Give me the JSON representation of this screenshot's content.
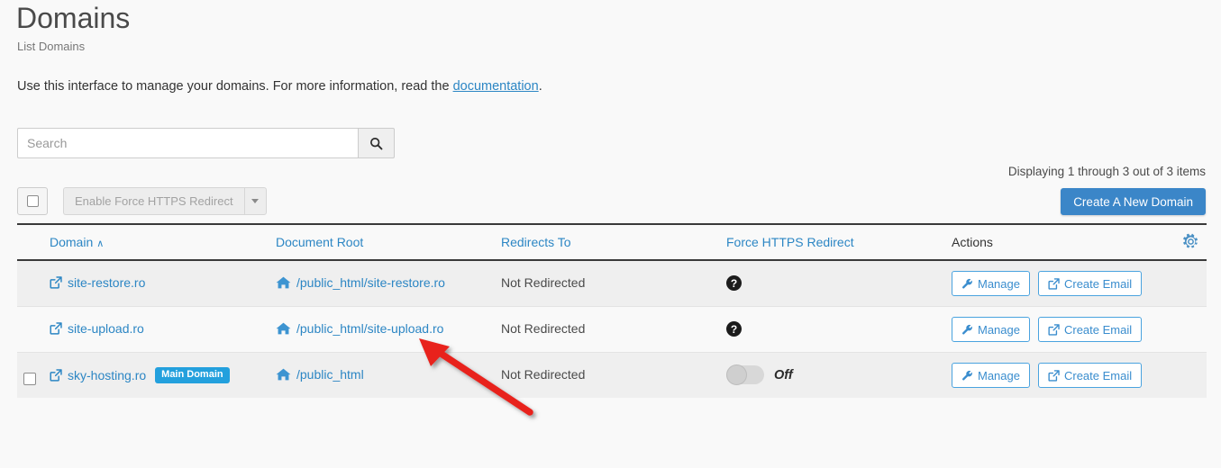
{
  "header": {
    "title": "Domains",
    "breadcrumb": "List Domains",
    "intro_before": "Use this interface to manage your domains. For more information, read the ",
    "intro_link": "documentation",
    "intro_after": "."
  },
  "search": {
    "value": "",
    "placeholder": "Search",
    "button_icon": "search-icon"
  },
  "toolbar": {
    "bulk_select_checked": false,
    "bulk_action_label": "Enable Force HTTPS Redirect",
    "bulk_action_disabled": true,
    "dropdown_icon": "caret-down-icon",
    "create_label": "Create A New Domain",
    "displaying": "Displaying 1 through 3 out of 3 items"
  },
  "table": {
    "columns": [
      {
        "label": "Domain",
        "sortable": true,
        "sorted": "asc",
        "sort_glyph": "∧"
      },
      {
        "label": "Document Root",
        "sortable": true
      },
      {
        "label": "Redirects To",
        "sortable": true
      },
      {
        "label": "Force HTTPS Redirect",
        "sortable": true
      },
      {
        "label": "Actions",
        "sortable": false
      }
    ],
    "settings_icon": "gear-icon",
    "rows": [
      {
        "checkbox": false,
        "domain": "site-restore.ro",
        "domain_icon": "external-link-icon",
        "badge": "",
        "document_root": "/public_html/site-restore.ro",
        "document_root_icon": "home-icon",
        "redirects_to": "Not Redirected",
        "force_https": {
          "type": "help",
          "icon": "question-circle-icon"
        },
        "actions": [
          {
            "label": "Manage",
            "icon": "wrench-icon"
          },
          {
            "label": "Create Email",
            "icon": "external-link-icon"
          }
        ]
      },
      {
        "checkbox": false,
        "domain": "site-upload.ro",
        "domain_icon": "external-link-icon",
        "badge": "",
        "document_root": "/public_html/site-upload.ro",
        "document_root_icon": "home-icon",
        "redirects_to": "Not Redirected",
        "force_https": {
          "type": "help",
          "icon": "question-circle-icon"
        },
        "actions": [
          {
            "label": "Manage",
            "icon": "wrench-icon"
          },
          {
            "label": "Create Email",
            "icon": "external-link-icon"
          }
        ]
      },
      {
        "checkbox": true,
        "domain": "sky-hosting.ro",
        "domain_icon": "external-link-icon",
        "badge": "Main Domain",
        "document_root": "/public_html",
        "document_root_icon": "home-icon",
        "redirects_to": "Not Redirected",
        "force_https": {
          "type": "toggle",
          "state": "Off",
          "on": false
        },
        "actions": [
          {
            "label": "Manage",
            "icon": "wrench-icon"
          },
          {
            "label": "Create Email",
            "icon": "external-link-icon"
          }
        ]
      }
    ]
  },
  "annotation": {
    "type": "arrow",
    "color": "#e8241f",
    "points_to": "document-root-site-upload"
  },
  "colors": {
    "link": "#2c86c4",
    "primary_button": "#3b86c8",
    "badge": "#23a0dd",
    "page_background": "#f9f9f9",
    "row_alt": "#efefef",
    "annotation_red": "#e8241f"
  }
}
